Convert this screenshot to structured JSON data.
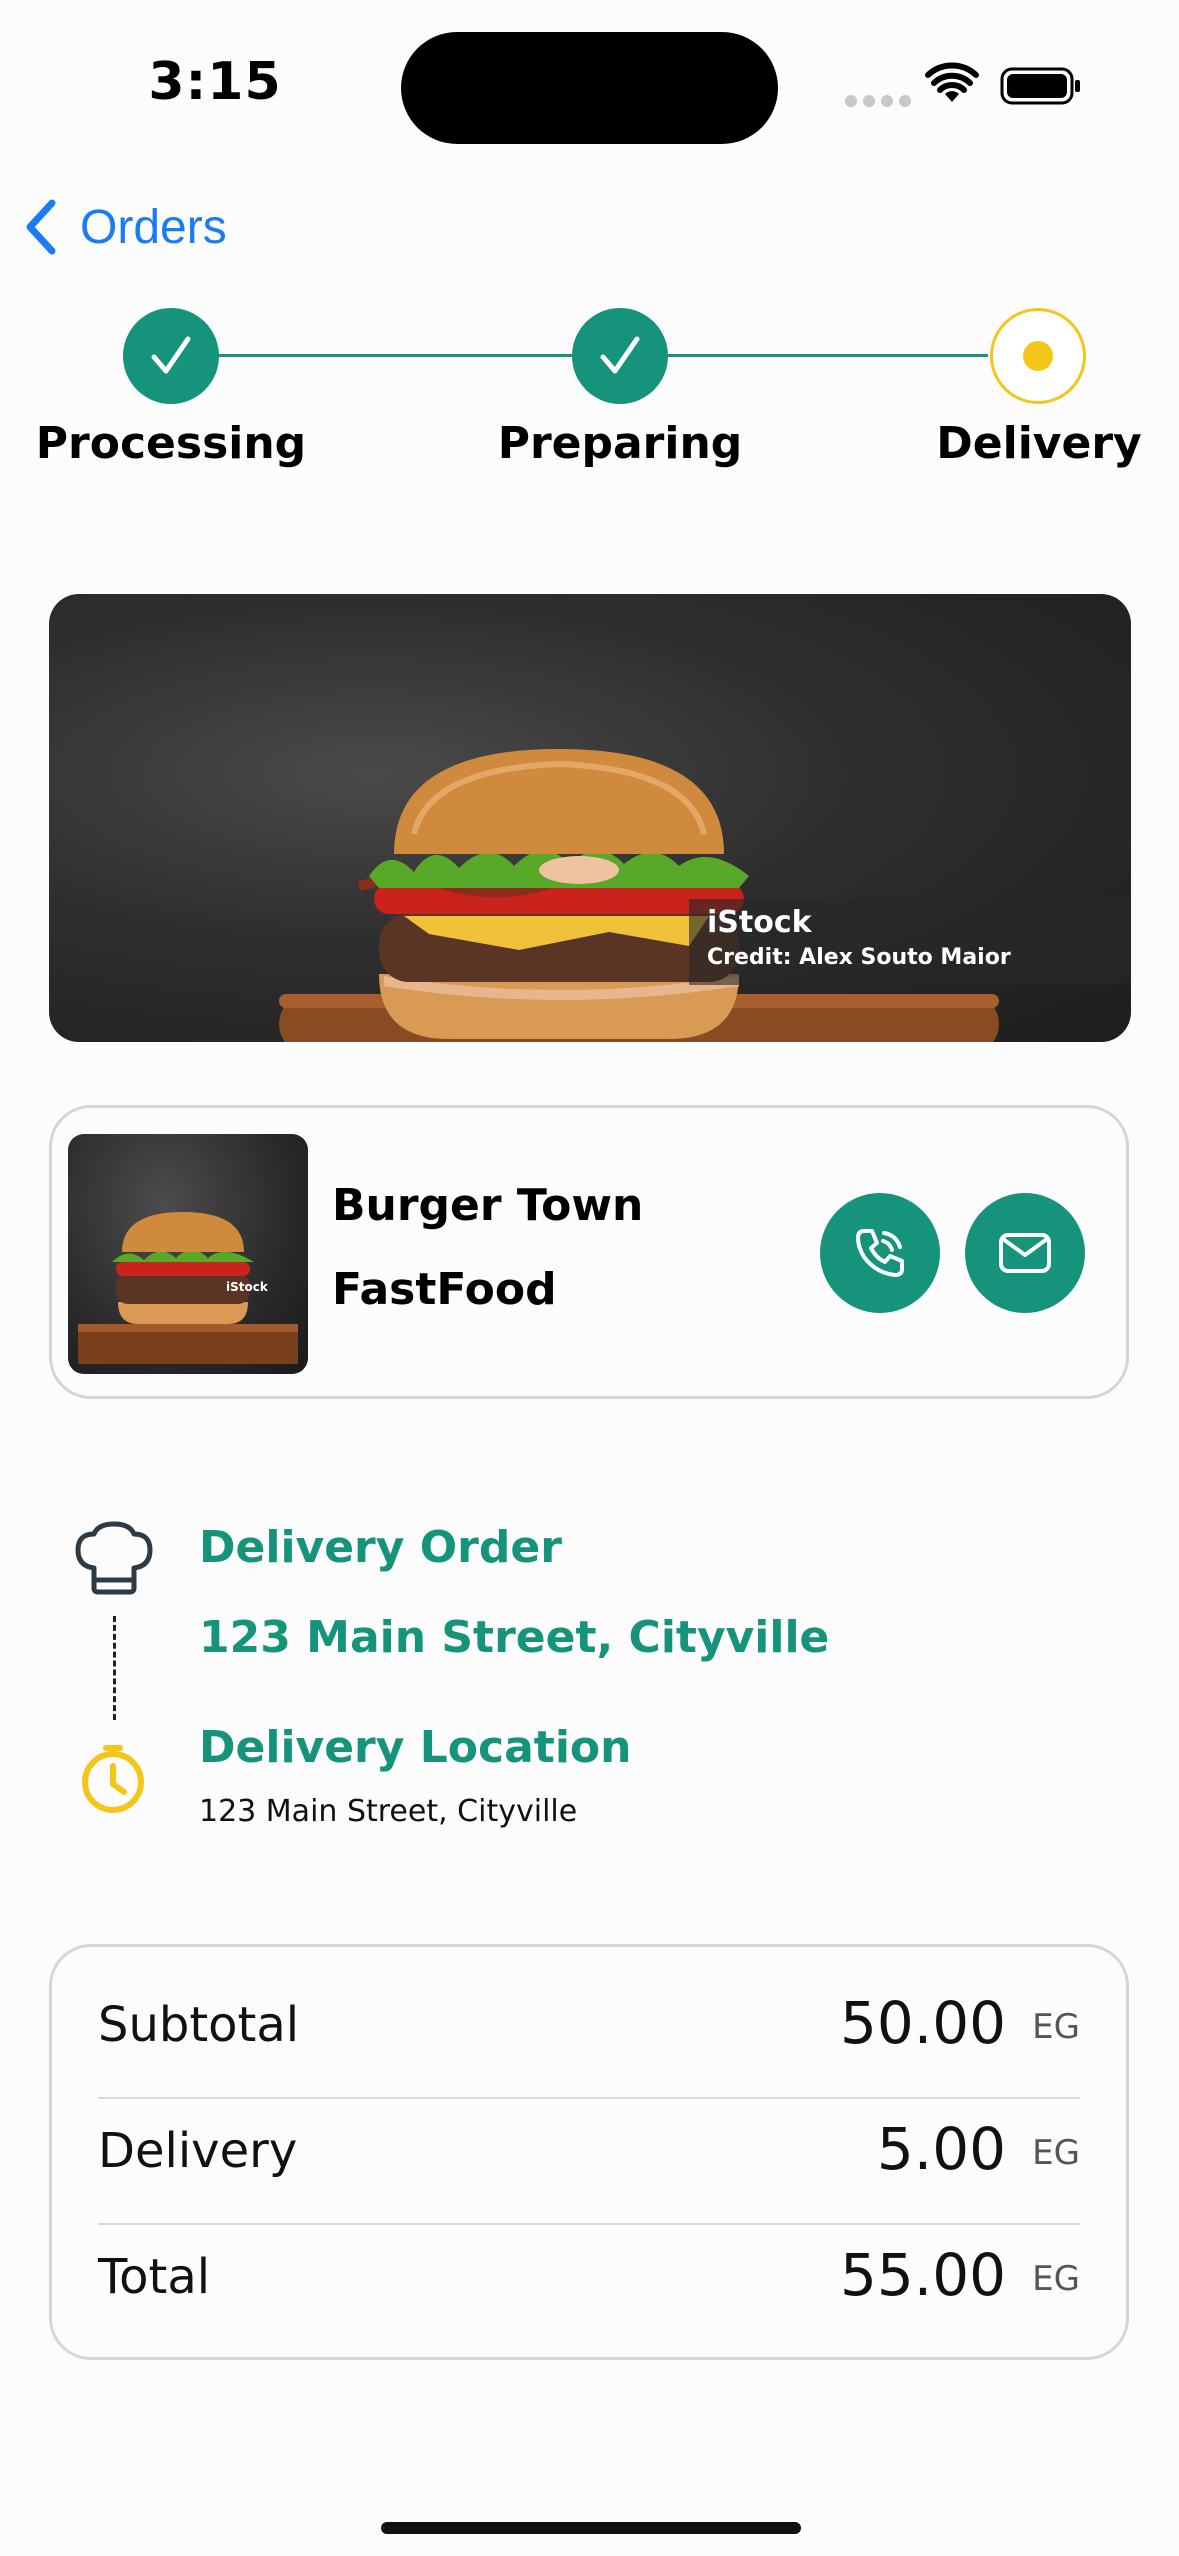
{
  "status_bar": {
    "time": "3:15"
  },
  "nav": {
    "back_label": "Orders"
  },
  "progress": {
    "steps": [
      {
        "label": "Processing",
        "state": "done"
      },
      {
        "label": "Preparing",
        "state": "done"
      },
      {
        "label": "Delivery",
        "state": "current"
      }
    ]
  },
  "hero": {
    "watermark_brand": "iStock",
    "watermark_credit": "Credit: Alex Souto Maior"
  },
  "restaurant": {
    "name": "Burger Town",
    "category": "FastFood",
    "thumb_watermark": "iStock"
  },
  "route": {
    "order_title": "Delivery Order",
    "order_address": "123 Main Street, Cityville",
    "location_title": "Delivery Location",
    "location_address": "123 Main Street, Cityville"
  },
  "summary": {
    "rows": [
      {
        "label": "Subtotal",
        "value": "50.00",
        "currency": "EG"
      },
      {
        "label": "Delivery",
        "value": "5.00",
        "currency": "EG"
      },
      {
        "label": "Total",
        "value": "55.00",
        "currency": "EG"
      }
    ]
  },
  "colors": {
    "accent": "#15937b",
    "current_step": "#f5c518",
    "link": "#1a7cf5"
  }
}
